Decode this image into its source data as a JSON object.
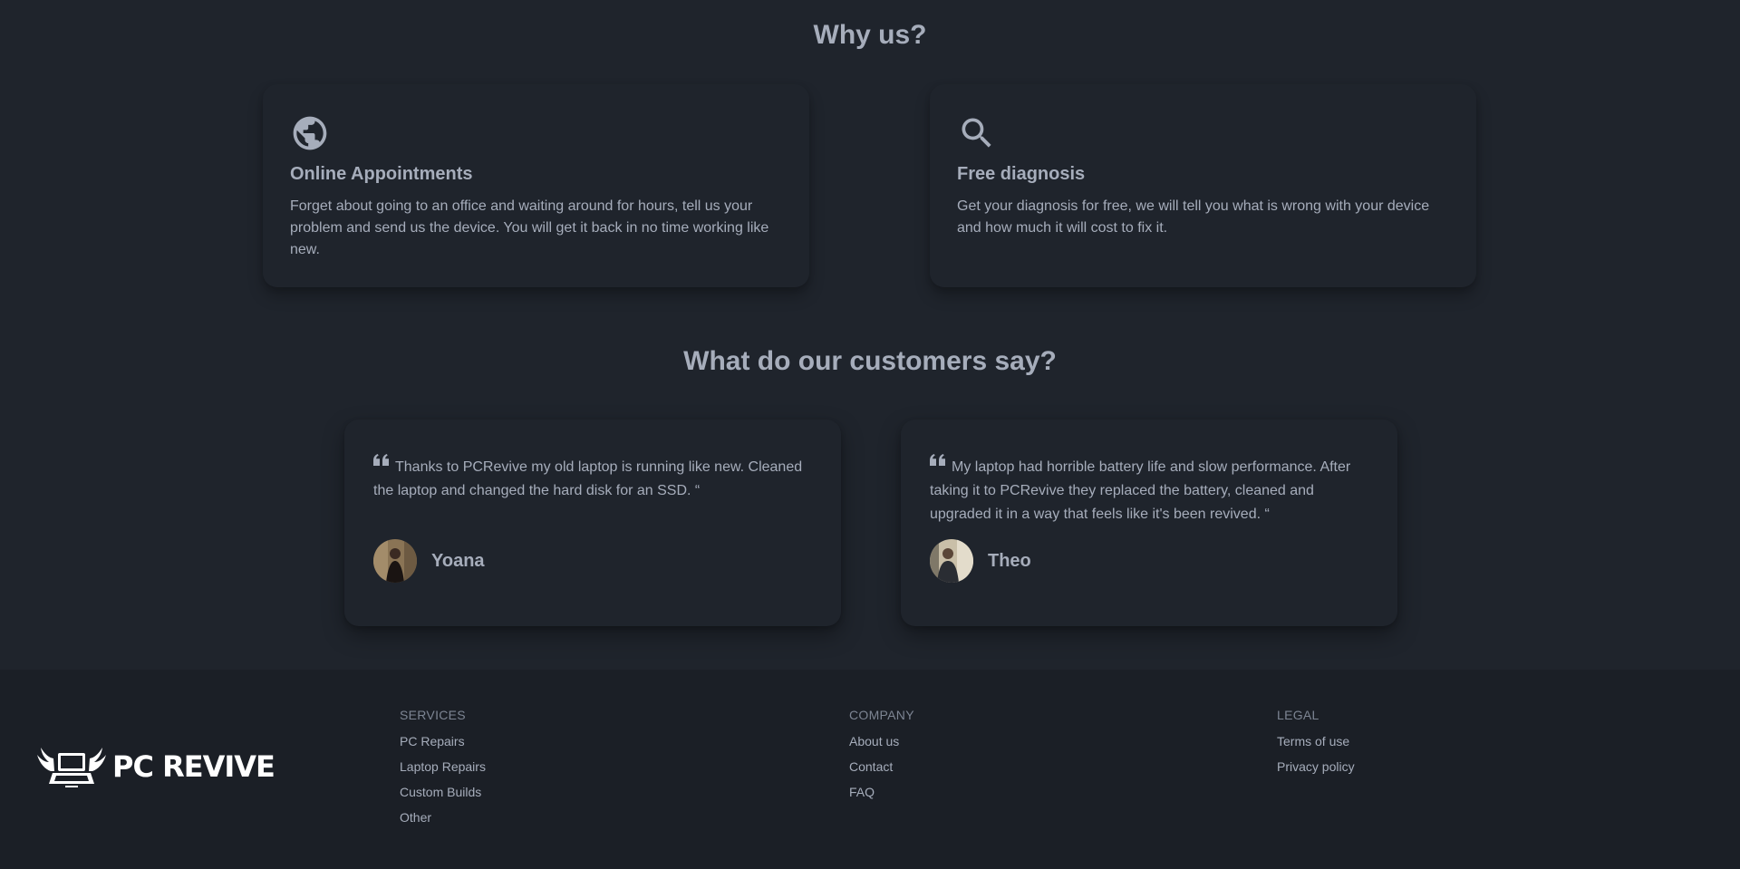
{
  "why": {
    "title": "Why us?",
    "features": [
      {
        "icon": "globe-icon",
        "title": "Online Appointments",
        "text": "Forget about going to an office and waiting around for hours, tell us your problem and send us the device. You will get it back in no time working like new."
      },
      {
        "icon": "search-icon",
        "title": "Free diagnosis",
        "text": "Get your diagnosis for free, we will tell you what is wrong with your device and how much it will cost to fix it."
      }
    ]
  },
  "testimonials": {
    "title": "What do our customers say?",
    "items": [
      {
        "text": "Thanks to PCRevive my old laptop is running like new. Cleaned the laptop and changed the hard disk for an SSD. “",
        "author": "Yoana"
      },
      {
        "text": "My laptop had horrible battery life and slow performance. After taking it to PCRevive they replaced the battery, cleaned and upgraded it in a way that feels like it's been revived. “",
        "author": "Theo"
      }
    ]
  },
  "footer": {
    "logo_text": "PC REVIVE",
    "services": {
      "title": "SERVICES",
      "links": [
        "PC Repairs",
        "Laptop Repairs",
        "Custom Builds",
        "Other"
      ]
    },
    "company": {
      "title": "COMPANY",
      "links": [
        "About us",
        "Contact",
        "FAQ"
      ]
    },
    "legal": {
      "title": "LEGAL",
      "links": [
        "Terms of use",
        "Privacy policy"
      ]
    }
  },
  "colors": {
    "background": "#1f242c",
    "footer_background": "#1b1f26",
    "text": "#a6adbb"
  }
}
